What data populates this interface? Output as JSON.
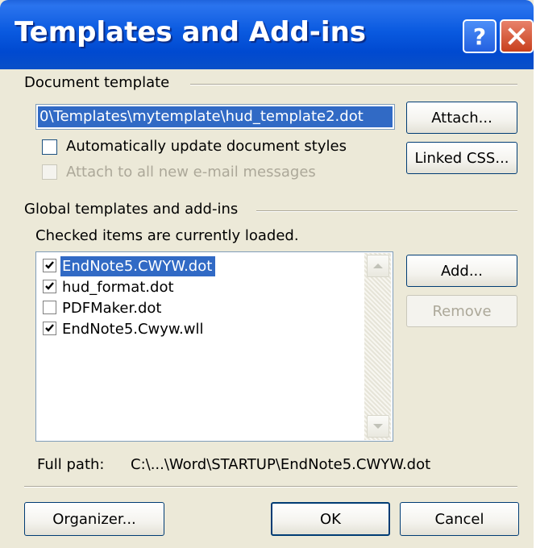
{
  "window": {
    "title": "Templates and Add-ins",
    "help_label": "?"
  },
  "document_template": {
    "group_label": "Document template",
    "path_value": "0\\Templates\\mytemplate\\hud_template2.dot",
    "attach_label": "Attach...",
    "linked_css_label": "Linked CSS...",
    "auto_update_label": "Automatically update document styles",
    "auto_update_checked": false,
    "attach_email_label": "Attach to all new e-mail messages",
    "attach_email_checked": false,
    "attach_email_enabled": false
  },
  "global_templates": {
    "group_label": "Global templates and add-ins",
    "hint": "Checked items are currently loaded.",
    "items": [
      {
        "label": "EndNote5.CWYW.dot",
        "checked": true,
        "selected": true
      },
      {
        "label": "hud_format.dot",
        "checked": true,
        "selected": false
      },
      {
        "label": "PDFMaker.dot",
        "checked": false,
        "selected": false
      },
      {
        "label": "EndNote5.Cwyw.wll",
        "checked": true,
        "selected": false
      }
    ],
    "add_label": "Add...",
    "remove_label": "Remove",
    "full_path_label": "Full path:",
    "full_path_value": "C:\\...\\Word\\STARTUP\\EndNote5.CWYW.dot"
  },
  "footer": {
    "organizer_label": "Organizer...",
    "ok_label": "OK",
    "cancel_label": "Cancel"
  }
}
